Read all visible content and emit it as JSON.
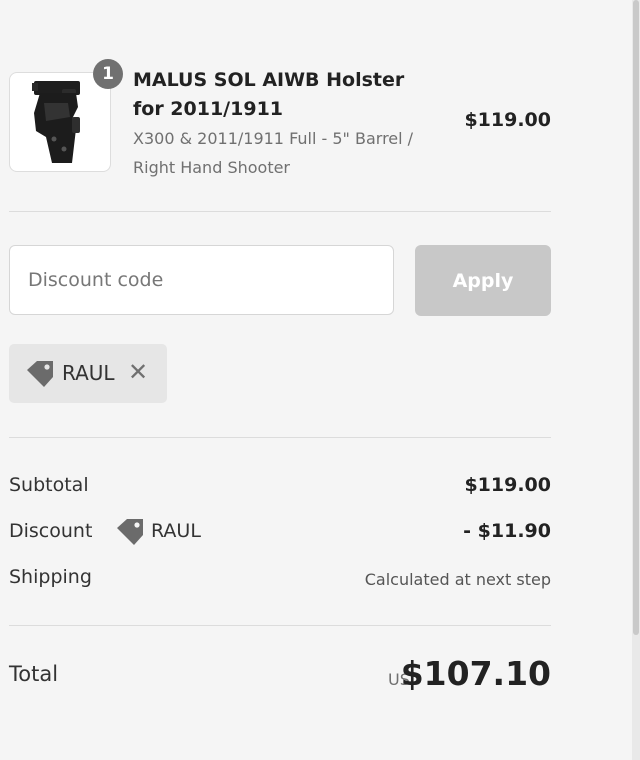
{
  "product": {
    "quantity": "1",
    "name": "MALUS SOL AIWB Holster for 2011/1911",
    "variant": "X300 & 2011/1911 Full - 5\" Barrel / Right Hand Shooter",
    "price": "$119.00",
    "image_icon": "holster-image"
  },
  "discount_form": {
    "placeholder": "Discount code",
    "value": "",
    "apply_label": "Apply"
  },
  "applied_code": {
    "label": "RAUL",
    "tag_icon": "tag-icon",
    "remove_icon": "close-icon",
    "remove_glyph": "✕"
  },
  "totals": {
    "subtotal_label": "Subtotal",
    "subtotal_value": "$119.00",
    "discount_label": "Discount",
    "discount_code": "RAUL",
    "discount_value": "- $11.90",
    "shipping_label": "Shipping",
    "shipping_value": "Calculated at next step",
    "total_label": "Total",
    "currency": "USD",
    "total_value": "$107.10"
  },
  "colors": {
    "background": "#f5f5f5",
    "apply_button_disabled": "#c8c8c8",
    "chip_background": "#e6e6e6",
    "badge": "#707070"
  }
}
